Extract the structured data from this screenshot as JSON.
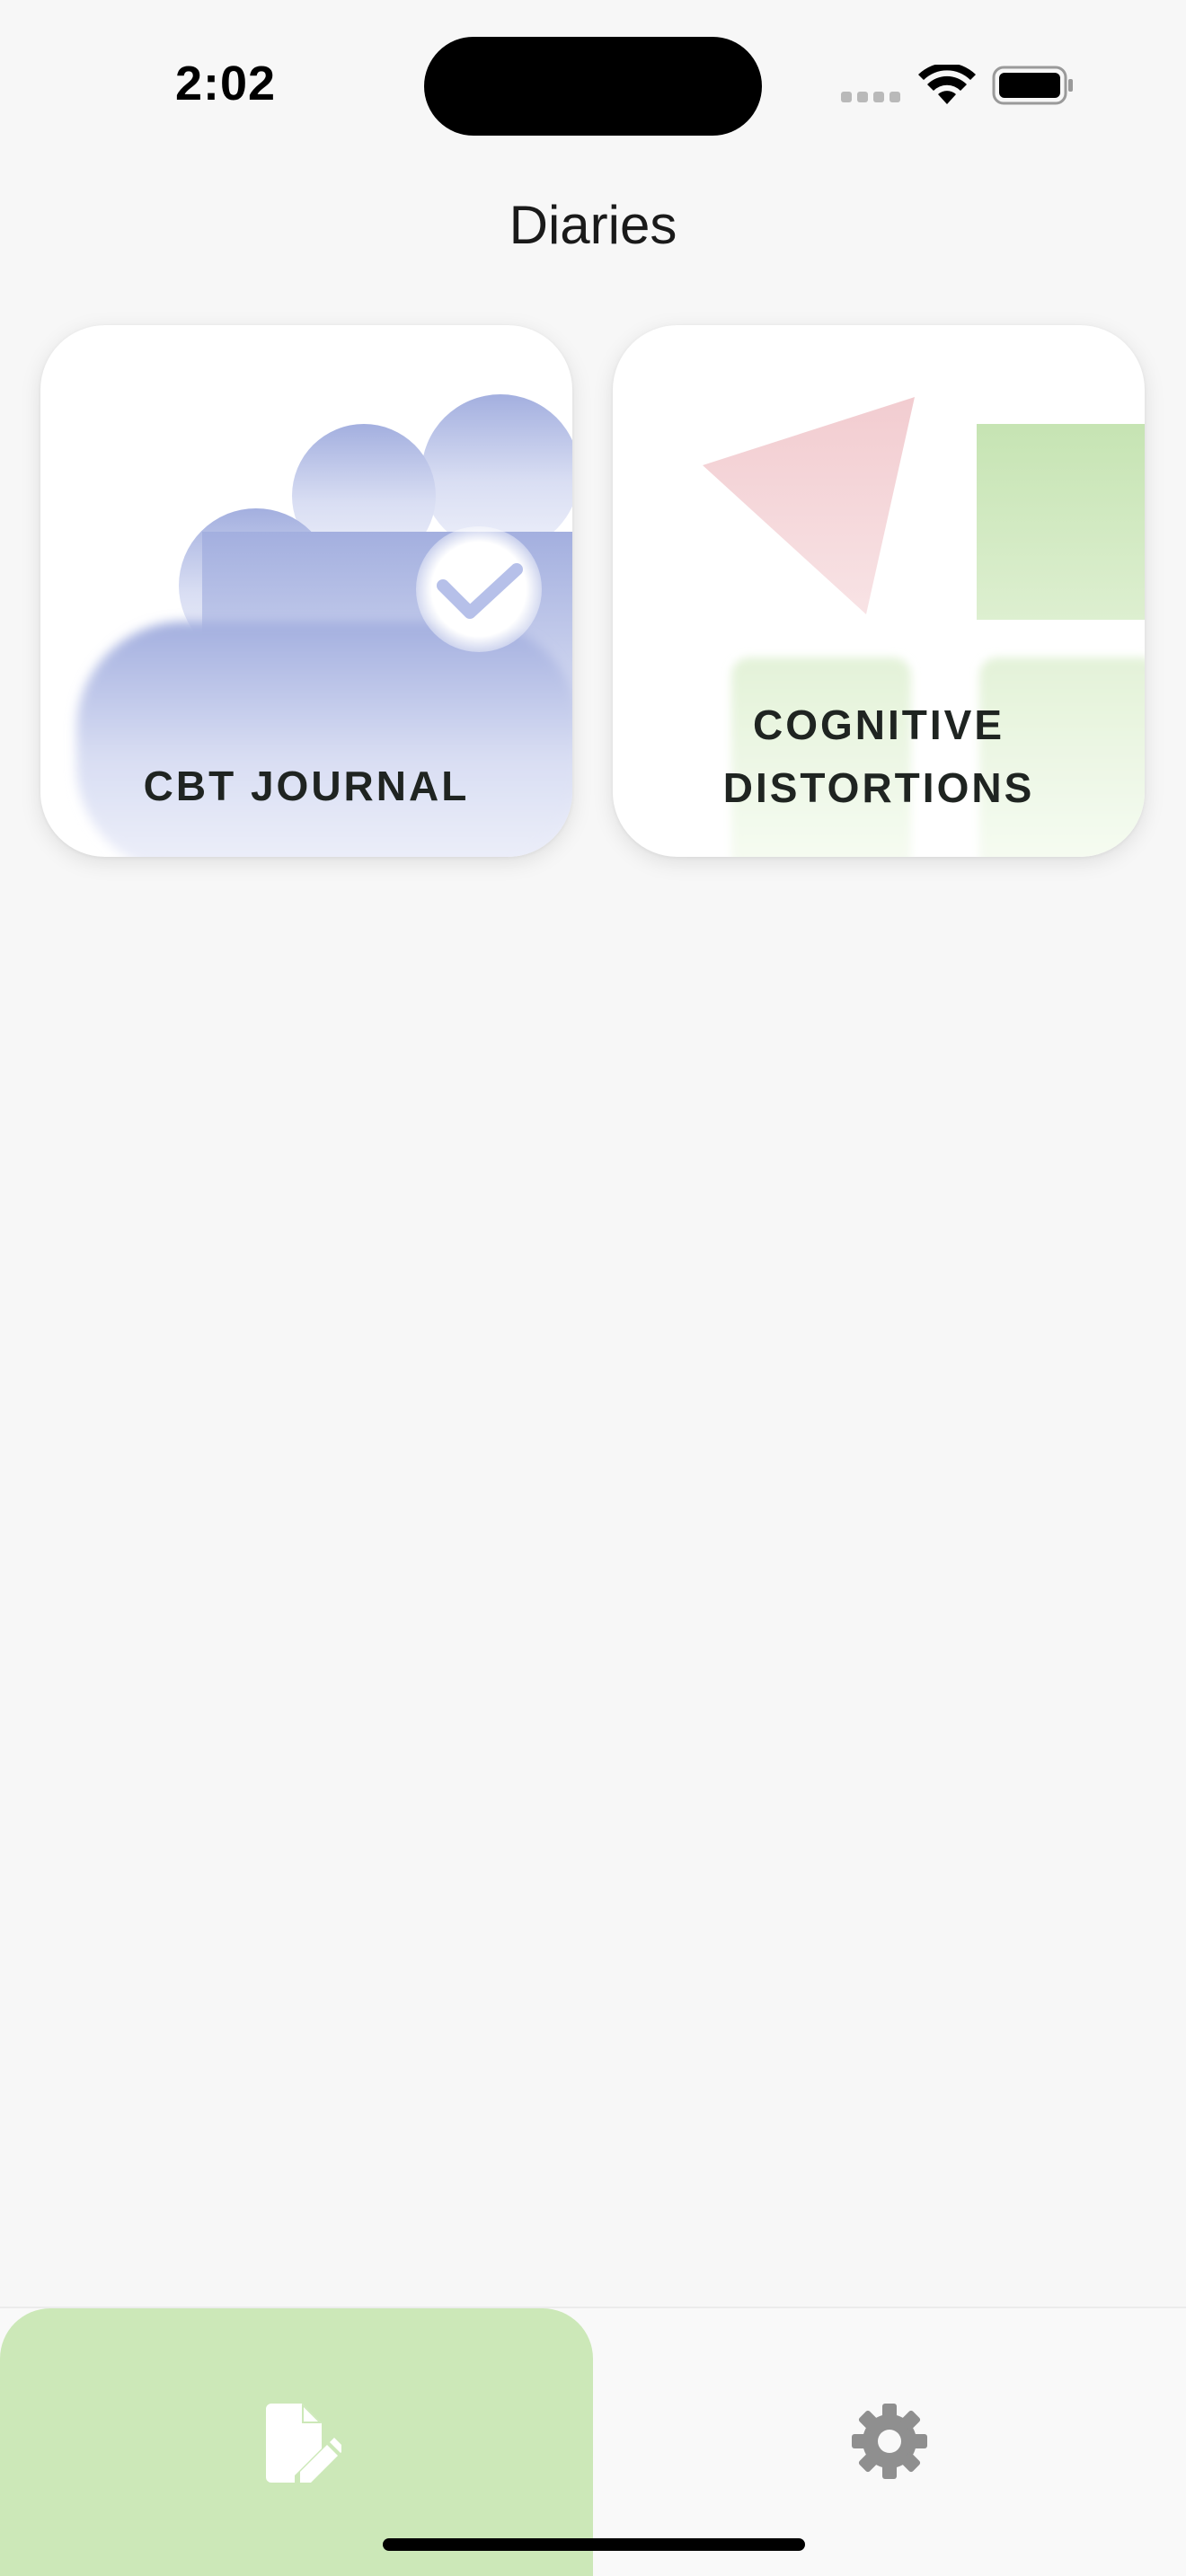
{
  "status_bar": {
    "time": "2:02"
  },
  "header": {
    "title": "Diaries"
  },
  "cards": [
    {
      "label": "CBT JOURNAL",
      "icon": "cloud-check-icon",
      "color": "#a7b3e0"
    },
    {
      "label_line1": "COGNITIVE",
      "label_line2": "DISTORTIONS",
      "icon": "shapes-icon",
      "colors": [
        "#f3d0d3",
        "#c9e6b7"
      ]
    }
  ],
  "bottom_nav": {
    "items": [
      {
        "icon": "edit-document-icon",
        "selected": true
      },
      {
        "icon": "gear-icon",
        "selected": false
      }
    ],
    "accent": "#cce8b8"
  }
}
